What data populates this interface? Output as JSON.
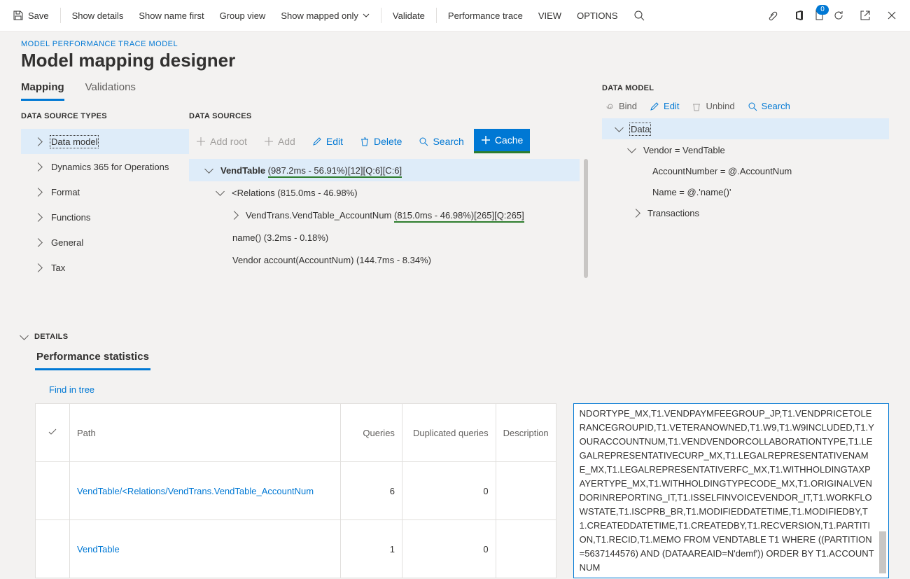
{
  "commandbar": {
    "save": "Save",
    "show_details": "Show details",
    "show_name_first": "Show name first",
    "group_view": "Group view",
    "show_mapped_only": "Show mapped only",
    "validate": "Validate",
    "performance_trace": "Performance trace",
    "view": "VIEW",
    "options": "OPTIONS",
    "badge_count": "0"
  },
  "header": {
    "breadcrumb": "MODEL PERFORMANCE TRACE MODEL",
    "title": "Model mapping designer",
    "tab_mapping": "Mapping",
    "tab_validations": "Validations"
  },
  "left": {
    "title": "DATA SOURCE TYPES",
    "items": {
      "data_model": "Data model",
      "d365": "Dynamics 365 for Operations",
      "format": "Format",
      "functions": "Functions",
      "general": "General",
      "tax": "Tax"
    }
  },
  "mid": {
    "title": "DATA SOURCES",
    "toolbar": {
      "add_root": "Add root",
      "add": "Add",
      "edit": "Edit",
      "delete": "Delete",
      "search": "Search",
      "cache": "Cache"
    },
    "tree": {
      "vendtable_pre": "VendTable ",
      "vendtable_stats": "(987.2ms - 56.91%)[12][Q:6][C:6]",
      "relations": "<Relations (815.0ms - 46.98%)",
      "vendtrans_pre": "VendTrans.VendTable_AccountNum ",
      "vendtrans_stats": "(815.0ms - 46.98%)[265][Q:265]",
      "name_fn": "name() (3.2ms - 0.18%)",
      "vendor_account": "Vendor account(AccountNum) (144.7ms - 8.34%)"
    }
  },
  "right": {
    "title": "DATA MODEL",
    "toolbar": {
      "bind": "Bind",
      "edit": "Edit",
      "unbind": "Unbind",
      "search": "Search"
    },
    "tree": {
      "data": "Data",
      "vendor": "Vendor = VendTable",
      "account_number": "AccountNumber = @.AccountNum",
      "name": "Name = @.'name()'",
      "transactions": "Transactions"
    }
  },
  "details": {
    "title": "DETAILS",
    "tab": "Performance statistics",
    "find_in_tree": "Find in tree",
    "columns": {
      "path": "Path",
      "queries": "Queries",
      "dup": "Duplicated queries",
      "desc": "Description"
    },
    "rows": [
      {
        "path": "VendTable/<Relations/VendTrans.VendTable_AccountNum",
        "q": "6",
        "d": "0"
      },
      {
        "path": "VendTable",
        "q": "1",
        "d": "0"
      }
    ],
    "sql": "NDORTYPE_MX,T1.VENDPAYMFEEGROUP_JP,T1.VENDPRICETOLERANCEGROUPID,T1.VETERANOWNED,T1.W9,T1.W9INCLUDED,T1.YOURACCOUNTNUM,T1.VENDVENDORCOLLABORATIONTYPE,T1.LEGALREPRESENTATIVECURP_MX,T1.LEGALREPRESENTATIVENAME_MX,T1.LEGALREPRESENTATIVERFC_MX,T1.WITHHOLDINGTAXPAYERTYPE_MX,T1.WITHHOLDINGTYPECODE_MX,T1.ORIGINALVENDORINREPORTING_IT,T1.ISSELFINVOICEVENDOR_IT,T1.WORKFLOWSTATE,T1.ISCPRB_BR,T1.MODIFIEDDATETIME,T1.MODIFIEDBY,T1.CREATEDDATETIME,T1.CREATEDBY,T1.RECVERSION,T1.PARTITION,T1.RECID,T1.MEMO FROM VENDTABLE T1 WHERE ((PARTITION=5637144576) AND (DATAAREAID=N'demf')) ORDER BY T1.ACCOUNTNUM"
  }
}
